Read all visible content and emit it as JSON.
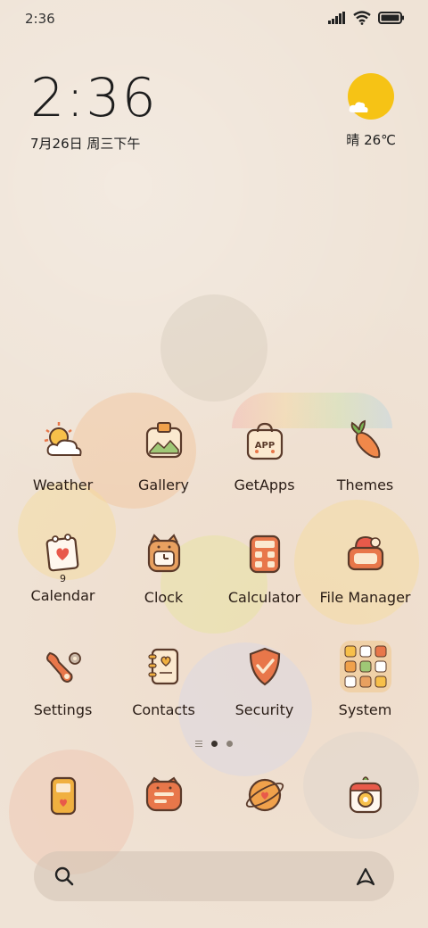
{
  "status_bar": {
    "time": "2:36"
  },
  "clock_widget": {
    "time": "2:36",
    "date": "7月26日 周三下午"
  },
  "weather_widget": {
    "condition": "晴",
    "temperature": "26℃"
  },
  "apps": [
    [
      {
        "label": "Weather",
        "icon": "weather-icon"
      },
      {
        "label": "Gallery",
        "icon": "gallery-icon"
      },
      {
        "label": "GetApps",
        "icon": "getapps-icon"
      },
      {
        "label": "Themes",
        "icon": "carrot-icon"
      }
    ],
    [
      {
        "label": "Calendar",
        "icon": "calendar-icon",
        "badge": "9"
      },
      {
        "label": "Clock",
        "icon": "clock-icon"
      },
      {
        "label": "Calculator",
        "icon": "calculator-icon"
      },
      {
        "label": "File Manager",
        "icon": "file-manager-icon"
      }
    ],
    [
      {
        "label": "Settings",
        "icon": "settings-icon"
      },
      {
        "label": "Contacts",
        "icon": "contacts-icon"
      },
      {
        "label": "Security",
        "icon": "security-icon"
      },
      {
        "label": "System",
        "icon": "system-folder-icon"
      }
    ]
  ],
  "dock": [
    {
      "icon": "phone-icon"
    },
    {
      "icon": "messages-icon"
    },
    {
      "icon": "browser-icon"
    },
    {
      "icon": "camera-icon"
    }
  ],
  "page_indicator": {
    "pages": 2,
    "active": 1
  },
  "colors": {
    "sun": "#f6c315",
    "icon_orange": "#e8774a",
    "icon_outline": "#5a3a2a",
    "icon_cream": "#fbe9cf"
  }
}
